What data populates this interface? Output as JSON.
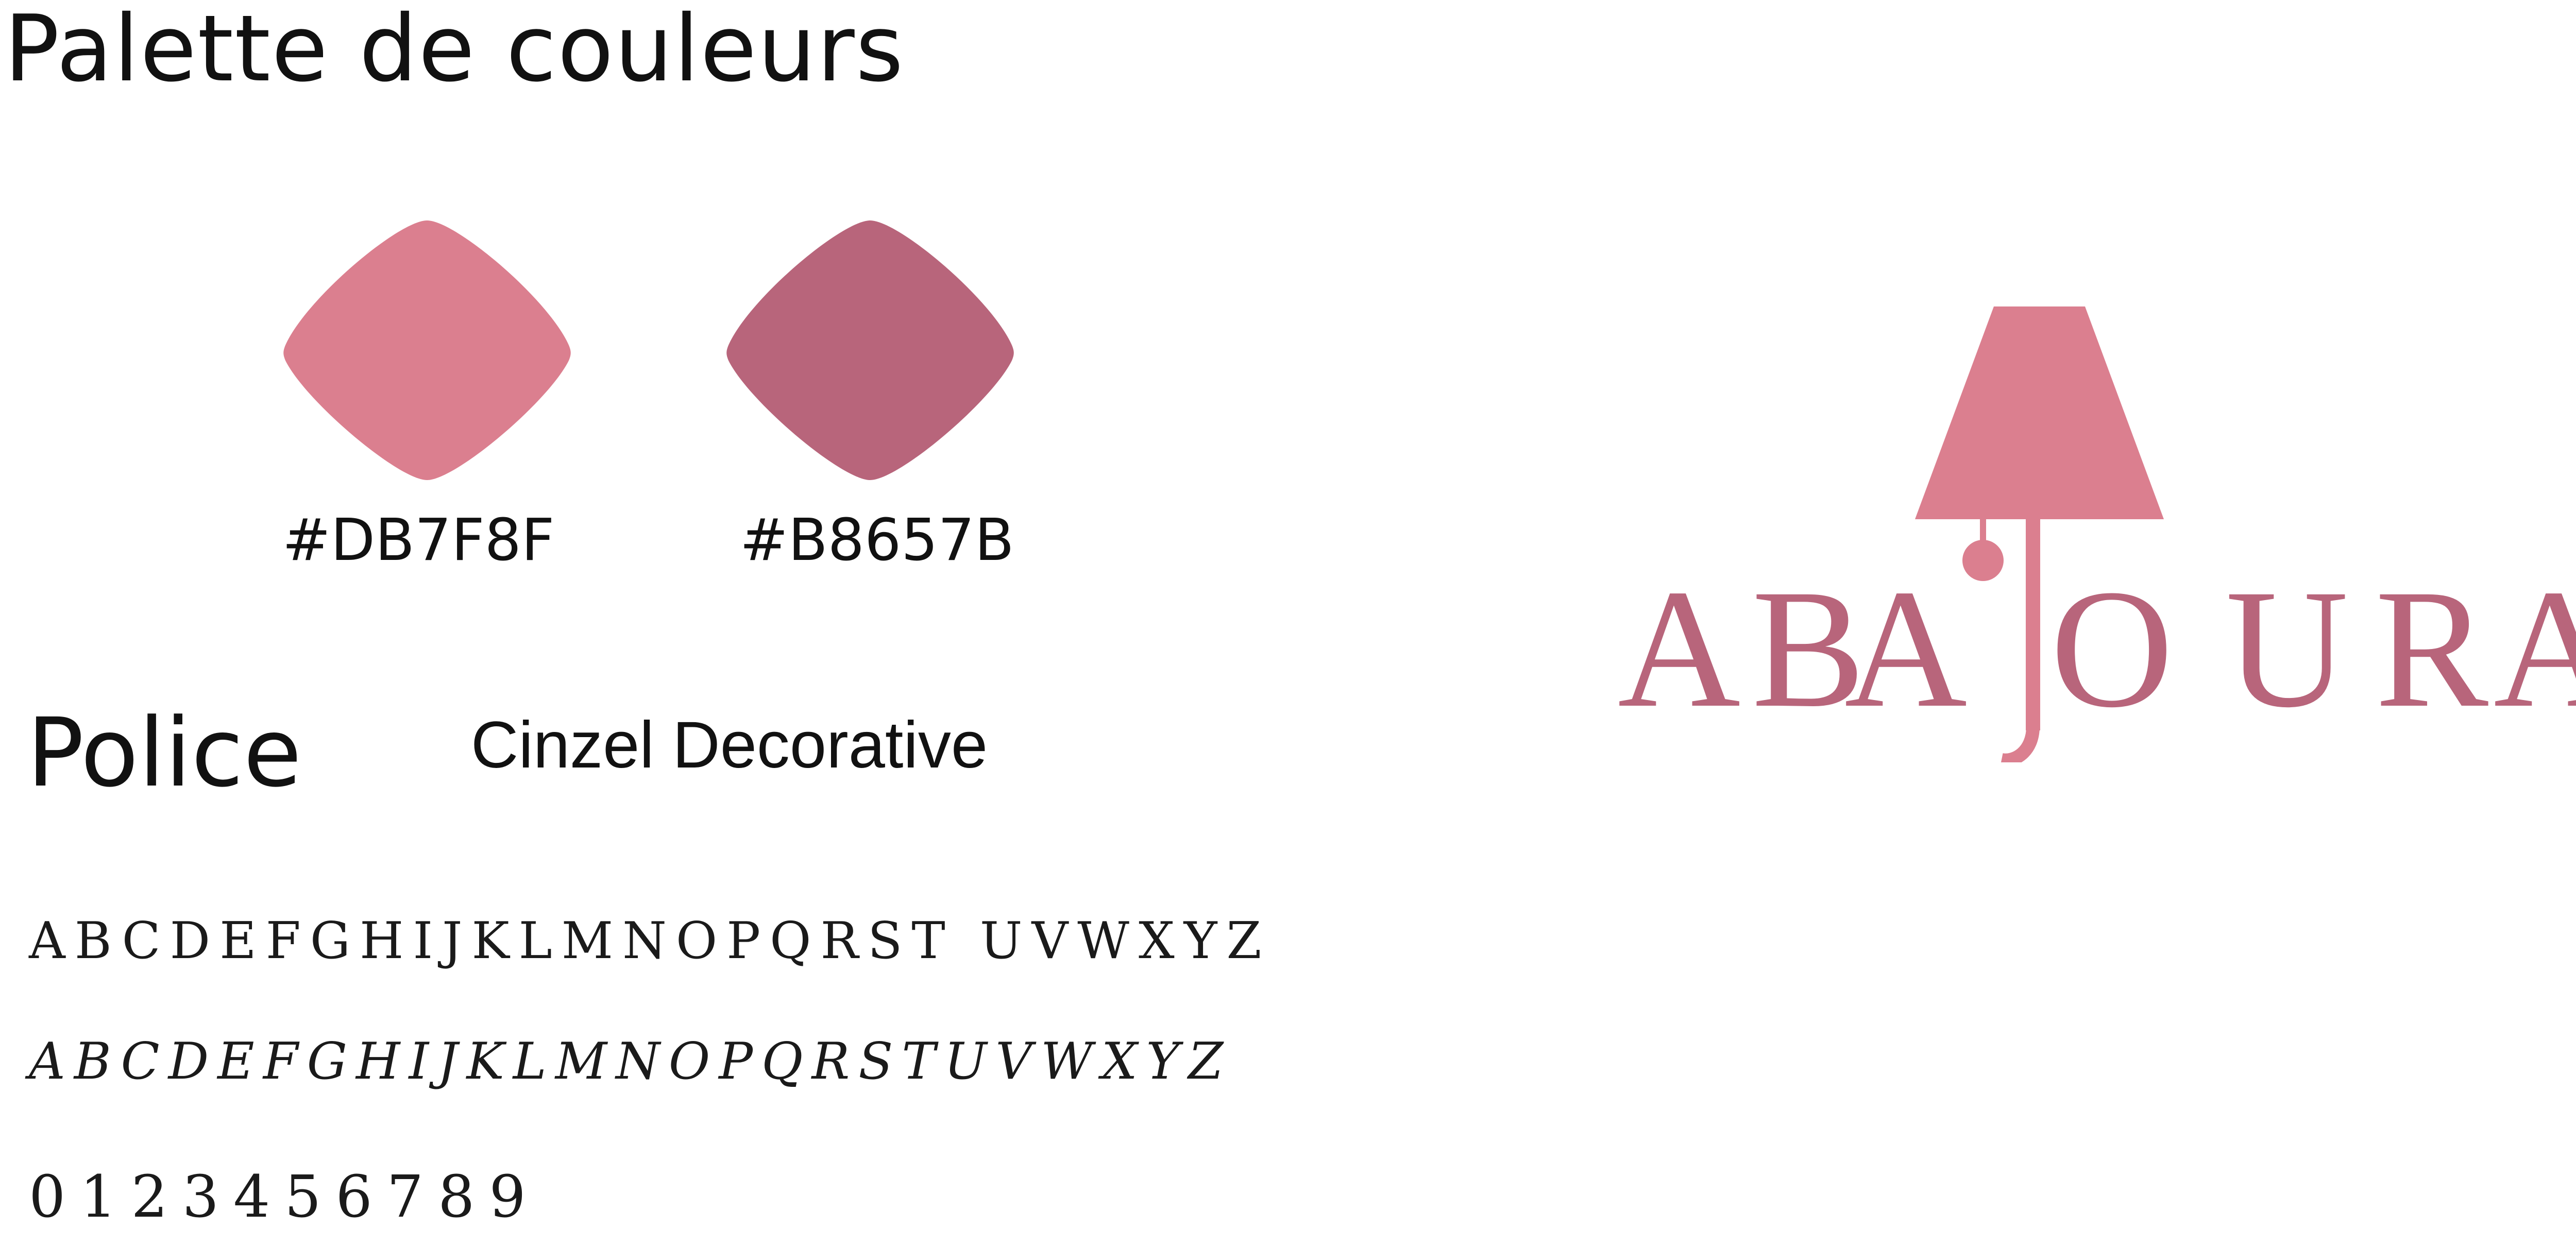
{
  "palette": {
    "title": "Palette de couleurs",
    "colors": [
      {
        "hex_label": "#DB7F8F",
        "value": "#DB7F8F"
      },
      {
        "hex_label": "#B8657B",
        "value": "#B8657B"
      }
    ]
  },
  "font": {
    "title": "Police",
    "name": "Cinzel Decorative",
    "specimen_uppercase": "ABCDEFGHIJKLMNOPQRST UVWXYZ",
    "specimen_decorative": "ABCDEFGHIJKLMNOPQRSTUVWXYZ",
    "specimen_digits": "0123456789"
  },
  "logo": {
    "wordmark": "ABAJOURA",
    "shade_color": "#DB7F8F",
    "text_color": "#B8657B",
    "icon": "lamp-icon"
  }
}
